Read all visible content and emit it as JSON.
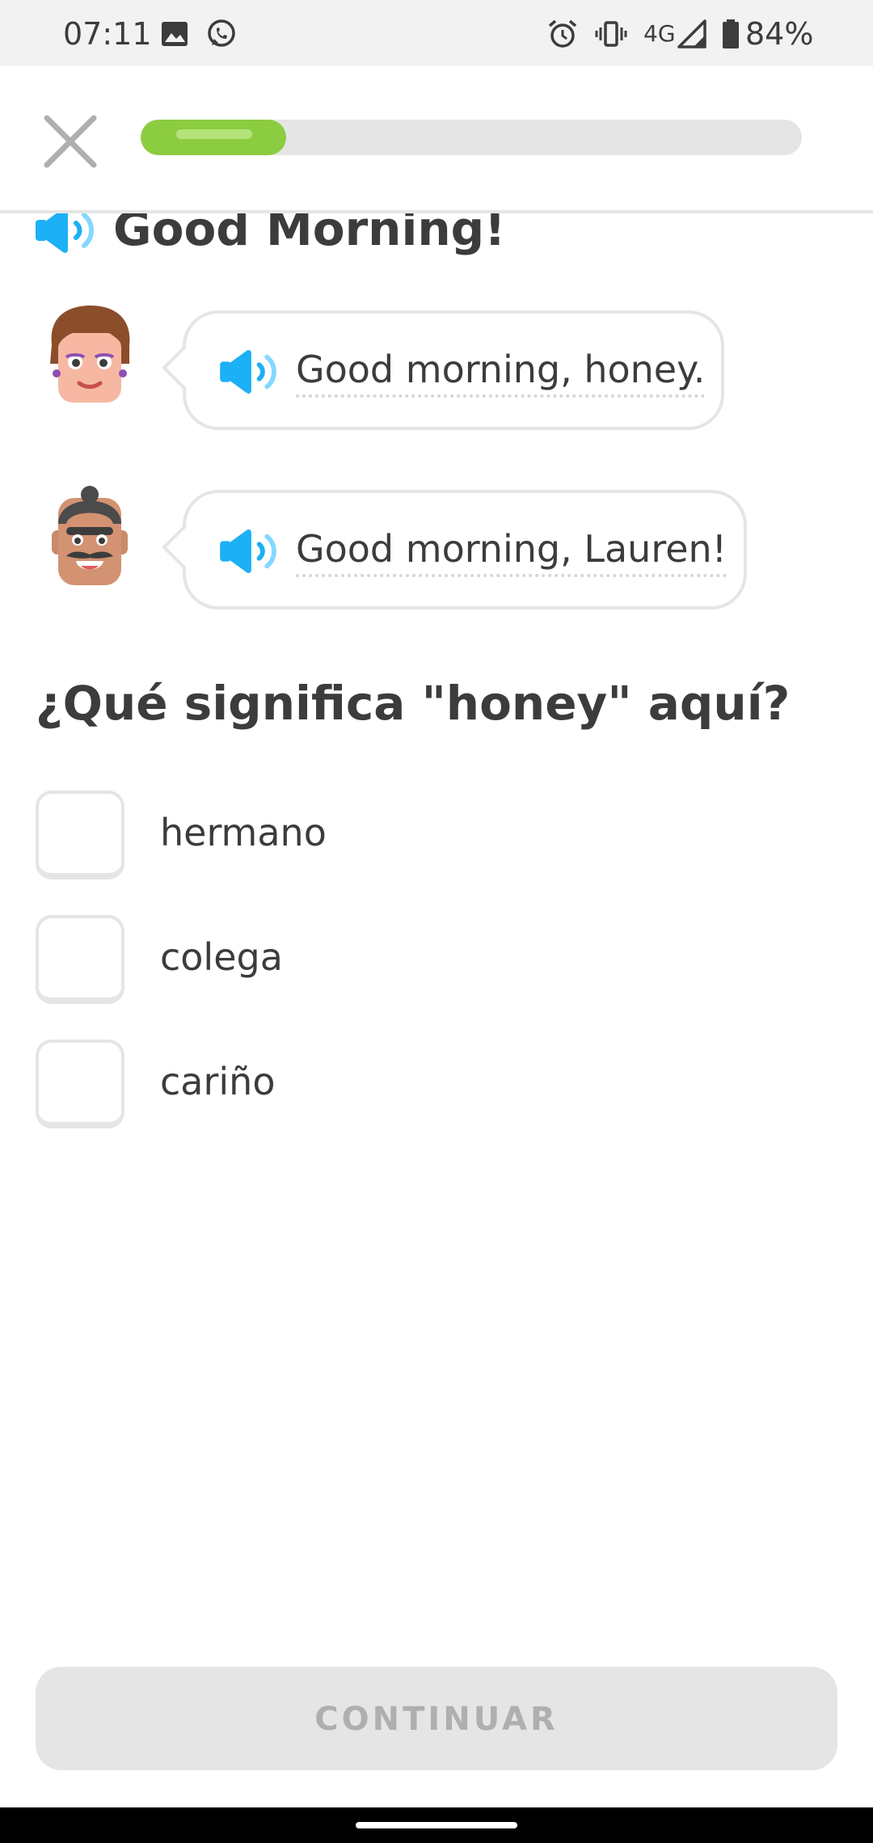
{
  "status_bar": {
    "time": "07:11",
    "network": "4G",
    "battery": "84%",
    "icons": [
      "image-icon",
      "whatsapp-icon",
      "alarm-icon",
      "vibrate-icon",
      "signal-icon",
      "battery-icon"
    ]
  },
  "header": {
    "close_icon": "close-icon",
    "progress": 0.22,
    "progress_color": "#8ccc40"
  },
  "story": {
    "title": "Good Morning!"
  },
  "dialogue": [
    {
      "speaker": "woman-avatar",
      "text": "Good morning, honey."
    },
    {
      "speaker": "man-avatar",
      "text": "Good morning, Lauren!"
    }
  ],
  "question": {
    "prompt": "¿Qué significa \"honey\" aquí?",
    "options": [
      "hermano",
      "colega",
      "cariño"
    ]
  },
  "footer": {
    "continue_label": "CONTINUAR"
  },
  "colors": {
    "speaker_blue": "#1cb0f6",
    "text": "#3c3c3c",
    "border": "#e5e5e5",
    "disabled_text": "#afafaf"
  }
}
